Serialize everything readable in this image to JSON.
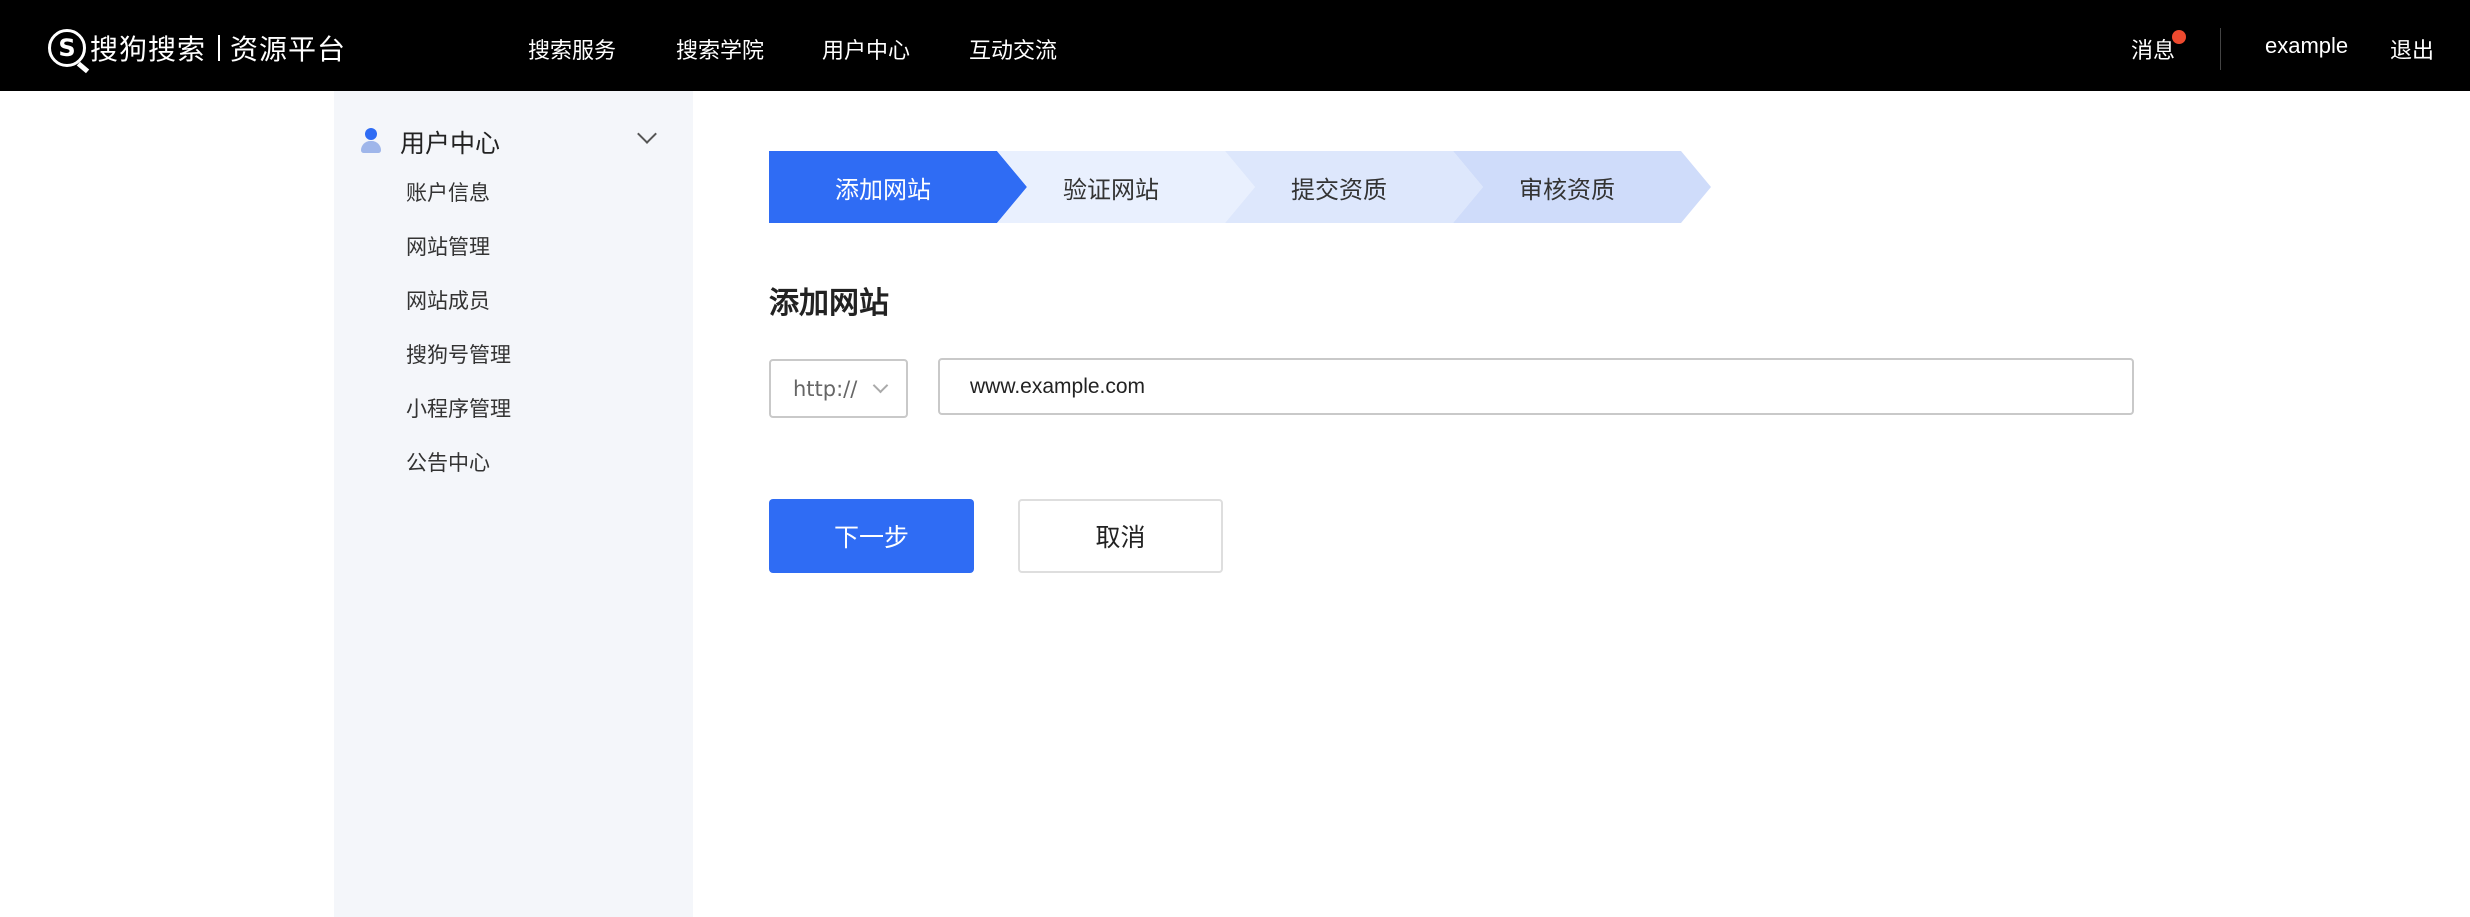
{
  "header": {
    "logo_text": "搜狗搜索",
    "logo_sub": "资源平台",
    "nav": [
      "搜索服务",
      "搜索学院",
      "用户中心",
      "互动交流"
    ],
    "messages_label": "消息",
    "username": "example",
    "logout_label": "退出"
  },
  "sidebar": {
    "section_title": "用户中心",
    "items": [
      "账户信息",
      "网站管理",
      "网站成员",
      "搜狗号管理",
      "小程序管理",
      "公告中心"
    ]
  },
  "steps": {
    "items": [
      "添加网站",
      "验证网站",
      "提交资质",
      "审核资质"
    ],
    "active_index": 0
  },
  "form": {
    "title": "添加网站",
    "protocol": "http://",
    "url_value": "www.example.com",
    "next_label": "下一步",
    "cancel_label": "取消"
  },
  "colors": {
    "accent": "#2f6cf4",
    "notify_dot": "#ee4a2f",
    "sidebar_bg": "#f4f6fa"
  }
}
